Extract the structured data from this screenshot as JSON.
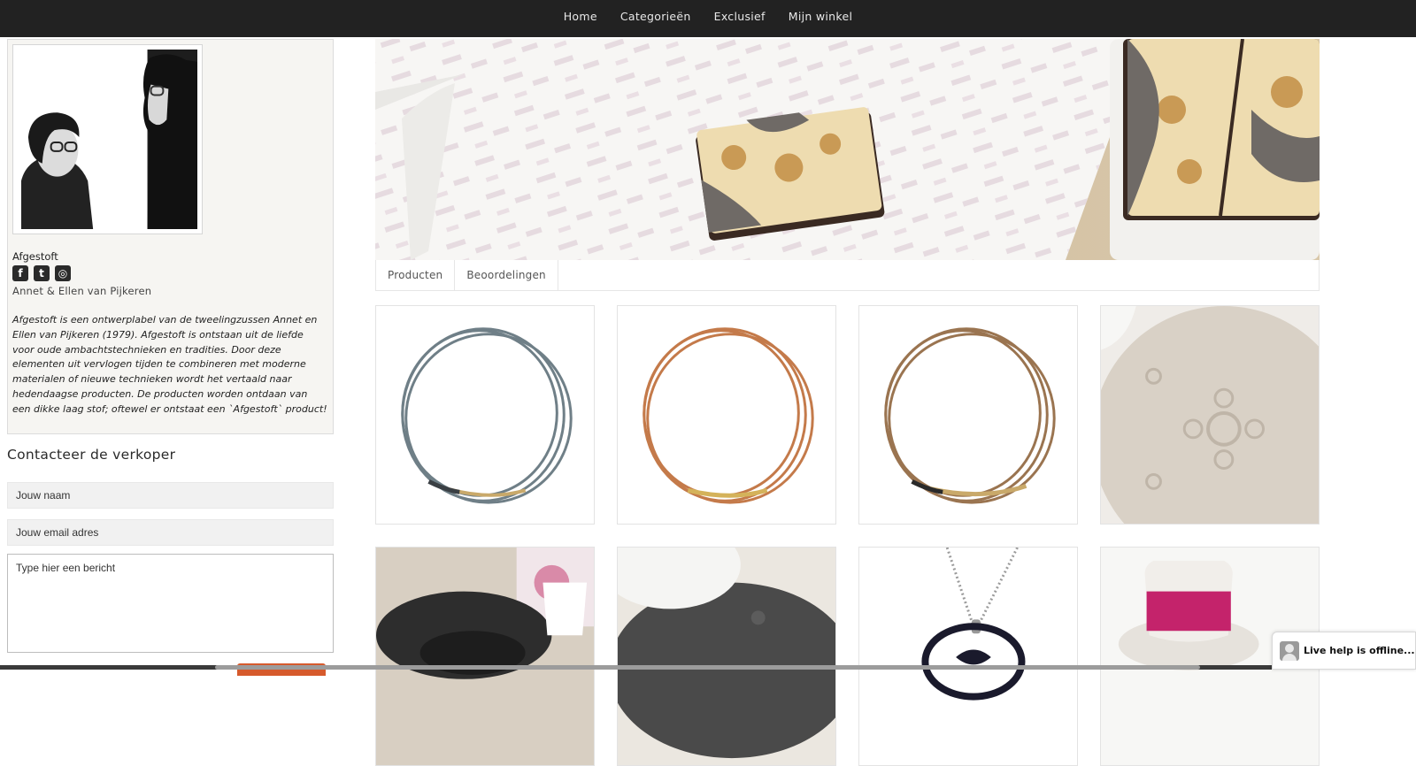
{
  "nav": {
    "items": [
      {
        "label": "Home"
      },
      {
        "label": "Categorieën"
      },
      {
        "label": "Exclusief"
      },
      {
        "label": "Mijn winkel"
      }
    ]
  },
  "profile": {
    "shop_name": "Afgestoft",
    "owners": "Annet & Ellen van Pijkeren",
    "bio": "Afgestoft is een ontwerplabel van de tweelingzussen Annet en Ellen van Pijkeren (1979). Afgestoft is ontstaan uit de liefde voor oude ambachtstechnieken en tradities. Door deze elementen uit vervlogen tijden te combineren met moderne materialen of nieuwe technieken wordt het vertaald naar hedendaagse producten. De producten worden ontdaan van een dikke laag stof; oftewel er ontstaat een `Afgestoft` product!",
    "socials": [
      {
        "icon": "facebook-icon",
        "glyph": "f"
      },
      {
        "icon": "twitter-icon",
        "glyph": "t"
      },
      {
        "icon": "instagram-icon",
        "glyph": "◎"
      }
    ]
  },
  "contact": {
    "title": "Contacteer de verkoper",
    "name_placeholder": "Jouw naam",
    "email_placeholder": "Jouw email adres",
    "message_placeholder": "Type hier een bericht"
  },
  "tabs": [
    {
      "label": "Producten"
    },
    {
      "label": "Beoordelingen"
    }
  ],
  "livehelp": {
    "label": "Live help is offline..."
  },
  "colors": {
    "nav_bg": "#222222",
    "sidebar_bg": "#f6f5f2",
    "accent": "#d65a2c"
  }
}
